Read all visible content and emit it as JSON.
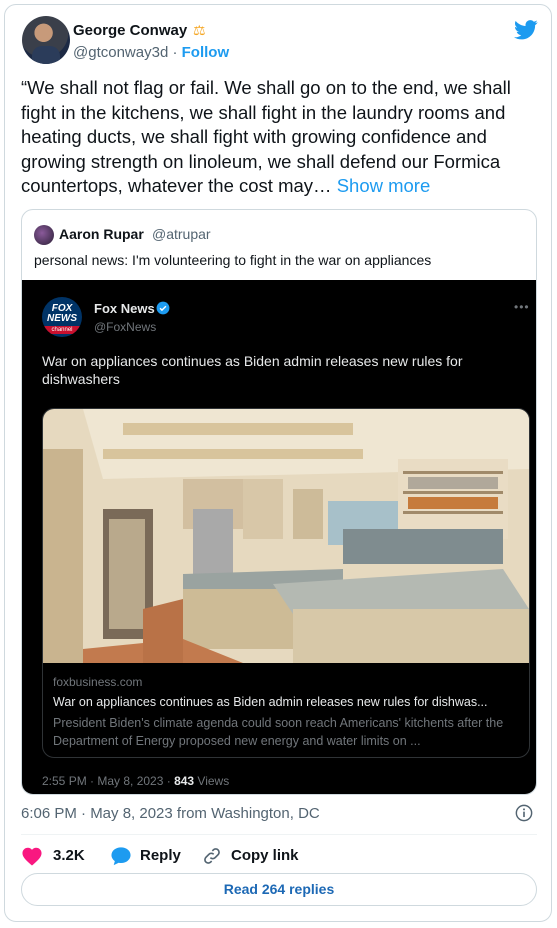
{
  "author": {
    "name": "George Conway",
    "badge_icon": "scales-icon",
    "handle": "@gtconway3d",
    "follow_label": "Follow"
  },
  "tweet": {
    "text": "“We shall not flag or fail. We shall go on to the end, we shall fight in the kitchens, we shall fight in the laundry rooms and heating ducts, we shall fight with growing confidence and growing strength on linoleum, we shall defend our Formica countertops, whatever the cost may…",
    "show_more": "Show more",
    "timestamp": "6:06 PM · May 8, 2023 from Washington, DC"
  },
  "quoted": {
    "name": "Aaron Rupar",
    "handle": "@atrupar",
    "text": "personal news: I'm volunteering to fight in the war on appliances",
    "embed": {
      "name": "Fox News",
      "handle": "@FoxNews",
      "logo_line1": "FOX",
      "logo_line2": "NEWS",
      "logo_line3": "channel",
      "text": "War on appliances continues as Biden admin releases new rules for dishwashers",
      "link": {
        "domain": "foxbusiness.com",
        "title": "War on appliances continues as Biden admin releases new rules for dishwas...",
        "description": "President Biden's climate agenda could soon reach Americans' kitchents after the Department of Energy proposed new energy and water limits on ..."
      },
      "time": "2:55 PM · May 8, 2023 · ",
      "views_count": "843",
      "views_label": " Views"
    }
  },
  "actions": {
    "likes": "3.2K",
    "reply_label": "Reply",
    "copy_label": "Copy link",
    "read_replies": "Read 264 replies"
  },
  "colors": {
    "accent": "#1d9bf0",
    "like": "#f91880",
    "dark_bg": "#000000"
  }
}
